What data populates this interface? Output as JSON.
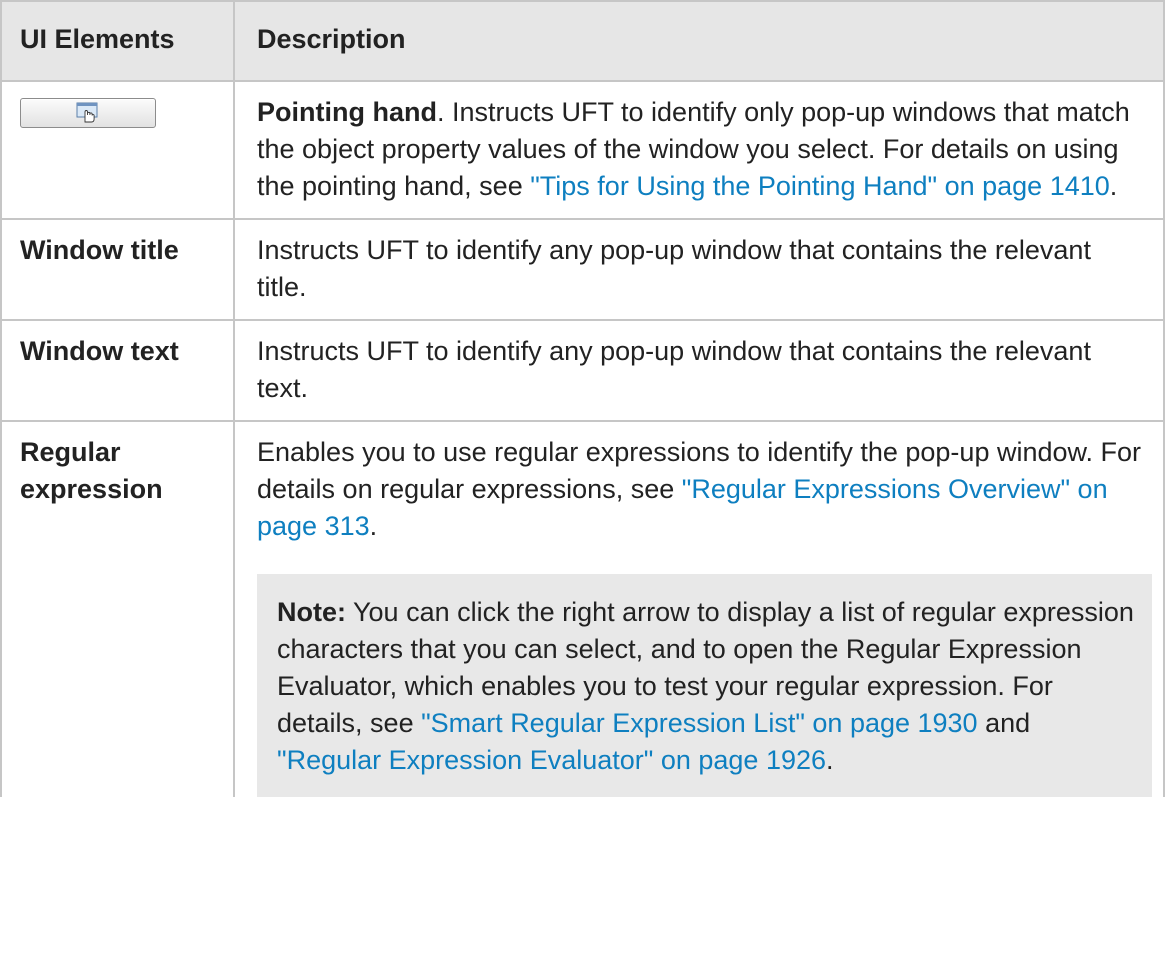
{
  "table": {
    "headers": {
      "ui_elements": "UI Elements",
      "description": "Description"
    },
    "rows": {
      "pointing_hand": {
        "button_icon": "pointing-hand-icon",
        "bold": "Pointing hand",
        "text1": ". Instructs UFT to identify only pop-up windows that match the object property values of the window you select. For details on using the pointing hand, see ",
        "link": "\"Tips for Using the Pointing Hand\" on page 1410",
        "text2": "."
      },
      "window_title": {
        "name": "Window title",
        "description": "Instructs UFT to identify any pop-up window that contains the relevant title."
      },
      "window_text": {
        "name": "Window text",
        "description": "Instructs UFT to identify any pop-up window that contains the relevant text."
      },
      "regular_expression": {
        "name": "Regular expression",
        "text1": "Enables you to use regular expressions to identify the pop-up window. For details on regular expressions, see ",
        "link": "\"Regular Expressions Overview\" on page 313",
        "text2": ".",
        "note": {
          "label": "Note:",
          "text1": " You can click the right arrow to display a list of regular expression characters that you can select, and to open the Regular Expression Evaluator, which enables you to test your regular expression. For details, see ",
          "link1": "\"Smart Regular Expression List\" on page 1930",
          "between": " and ",
          "link2": "\"Regular Expression Evaluator\" on page 1926",
          "text2": "."
        }
      }
    }
  }
}
